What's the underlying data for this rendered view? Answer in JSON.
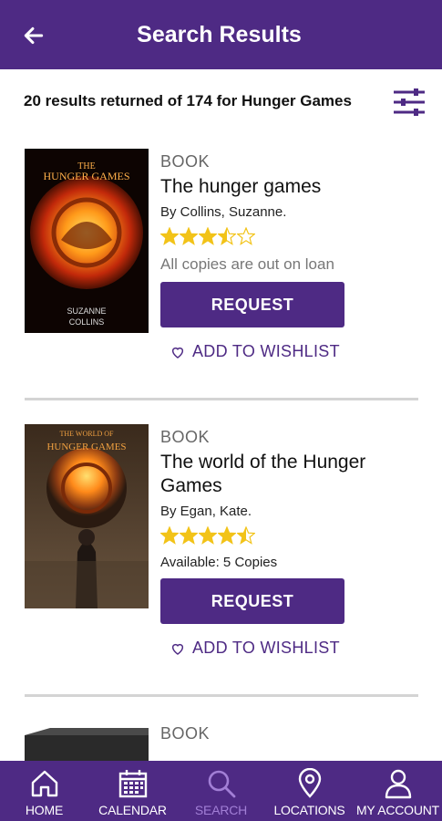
{
  "header": {
    "title": "Search Results",
    "back_icon": "arrow-left-icon"
  },
  "summary": {
    "text": "20 results returned of 174 for Hunger Games",
    "filter_icon": "sliders-icon"
  },
  "results": [
    {
      "type": "BOOK",
      "title": "The hunger games",
      "author": "By  Collins, Suzanne.",
      "rating": 3.5,
      "availability": "All copies are out on loan",
      "request_label": "REQUEST",
      "wishlist_label": "ADD TO WISHLIST",
      "cover_top_text": "THE HUNGER GAMES",
      "cover_author": "SUZANNE COLLINS"
    },
    {
      "type": "BOOK",
      "title": "The world of the Hunger Games",
      "author": "By  Egan, Kate.",
      "rating": 4.5,
      "availability": "Available:  5 Copies",
      "request_label": "REQUEST",
      "wishlist_label": "ADD TO WISHLIST",
      "cover_top_text": "THE WORLD OF THE HUNGER GAMES"
    },
    {
      "type": "BOOK"
    }
  ],
  "tabs": [
    {
      "label": "HOME",
      "icon": "home-icon",
      "active": false
    },
    {
      "label": "CALENDAR",
      "icon": "calendar-icon",
      "active": false
    },
    {
      "label": "SEARCH",
      "icon": "search-icon",
      "active": true
    },
    {
      "label": "LOCATIONS",
      "icon": "location-pin-icon",
      "active": false
    },
    {
      "label": "MY ACCOUNT",
      "icon": "user-icon",
      "active": false
    }
  ],
  "colors": {
    "brand": "#4e2a84",
    "active_tab": "#a27fd6",
    "star": "#f2c318"
  }
}
